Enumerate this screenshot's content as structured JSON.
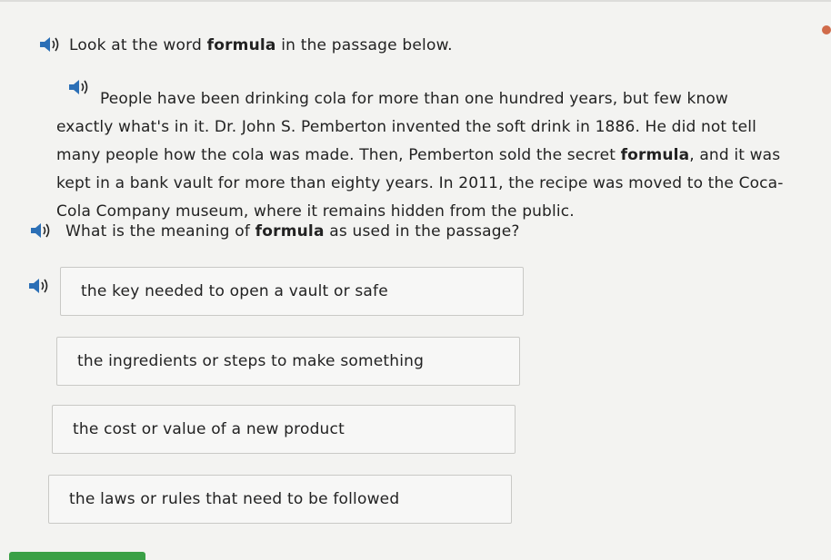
{
  "prompt": {
    "before": "Look at the word ",
    "word": "formula",
    "after": " in the passage below."
  },
  "passage": {
    "text_1": "People have been drinking cola for more than one hundred years, but few know exactly what's in it. Dr. John S. Pemberton invented the soft drink in 1886. He did not tell many people how the cola was made. Then, Pemberton sold the secret ",
    "word": "formula",
    "text_2": ", and it was kept in a bank vault for more than eighty years. In 2011, the recipe was moved to the Coca-Cola Company museum, where it remains hidden from the public."
  },
  "question": {
    "before": "What is the meaning of ",
    "word": "formula",
    "after": " as used in the passage?"
  },
  "choices": [
    {
      "label": "the key needed to open a vault or safe"
    },
    {
      "label": "the ingredients or steps to make something"
    },
    {
      "label": "the cost or value of a new product"
    },
    {
      "label": "the laws or rules that need to be followed"
    }
  ],
  "icons": {
    "audio": "speaker-icon"
  },
  "colors": {
    "speaker": "#2b6fb6",
    "progress": "#3aa046",
    "accent_dot": "#d06b4a"
  }
}
